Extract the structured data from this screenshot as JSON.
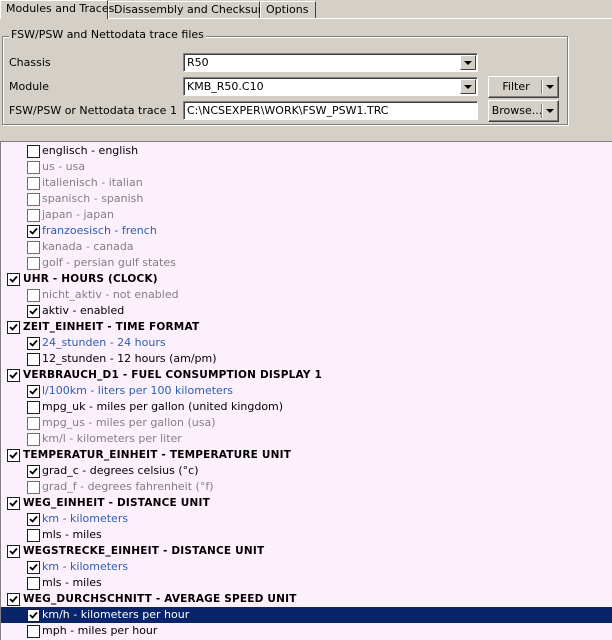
{
  "tabs": [
    {
      "label": "Modules and Traces",
      "active": true
    },
    {
      "label": "Disassembly and Checksums",
      "active": false
    },
    {
      "label": "Options",
      "active": false
    }
  ],
  "group": {
    "title": "FSW/PSW and Nettodata trace files",
    "chassis_label": "Chassis",
    "chassis_value": "R50",
    "module_label": "Module",
    "module_value": "KMB_R50.C10",
    "trace_label": "FSW/PSW or Nettodata trace 1",
    "trace_value": "C:\\NCSEXPER\\WORK\\FSW_PSW1.TRC",
    "filter_label": "Filter",
    "browse_label": "Browse..."
  },
  "tree": {
    "rows": [
      {
        "text": "englisch  -  english",
        "level": 1,
        "checked": false,
        "style": "normal"
      },
      {
        "text": "us  -  usa",
        "level": 1,
        "checked": false,
        "style": "grey"
      },
      {
        "text": "italienisch  -  italian",
        "level": 1,
        "checked": false,
        "style": "grey"
      },
      {
        "text": "spanisch  -  spanish",
        "level": 1,
        "checked": false,
        "style": "grey"
      },
      {
        "text": "japan  -  japan",
        "level": 1,
        "checked": false,
        "style": "grey"
      },
      {
        "text": "franzoesisch  -  french",
        "level": 1,
        "checked": true,
        "style": "blue"
      },
      {
        "text": "kanada  -  canada",
        "level": 1,
        "checked": false,
        "style": "grey"
      },
      {
        "text": "golf  -  persian gulf states",
        "level": 1,
        "checked": false,
        "style": "grey"
      },
      {
        "text": "UHR  -  HOURS (CLOCK)",
        "level": 0,
        "checked": true,
        "style": "head"
      },
      {
        "text": "nicht_aktiv  -  not enabled",
        "level": 1,
        "checked": false,
        "style": "grey"
      },
      {
        "text": "aktiv  -  enabled",
        "level": 1,
        "checked": true,
        "style": "normal"
      },
      {
        "text": "ZEIT_EINHEIT  -  TIME FORMAT",
        "level": 0,
        "checked": true,
        "style": "head"
      },
      {
        "text": "24_stunden  -  24 hours",
        "level": 1,
        "checked": true,
        "style": "blue"
      },
      {
        "text": "12_stunden  -  12 hours (am/pm)",
        "level": 1,
        "checked": false,
        "style": "normal"
      },
      {
        "text": "VERBRAUCH_D1  -  FUEL CONSUMPTION DISPLAY 1",
        "level": 0,
        "checked": true,
        "style": "head"
      },
      {
        "text": "l/100km  -  liters per 100 kilometers",
        "level": 1,
        "checked": true,
        "style": "blue"
      },
      {
        "text": "mpg_uk  -  miles per gallon (united kingdom)",
        "level": 1,
        "checked": false,
        "style": "normal"
      },
      {
        "text": "mpg_us  -  miles per gallon (usa)",
        "level": 1,
        "checked": false,
        "style": "grey"
      },
      {
        "text": "km/l  -  kilometers per liter",
        "level": 1,
        "checked": false,
        "style": "grey"
      },
      {
        "text": "TEMPERATUR_EINHEIT  -  TEMPERATURE UNIT",
        "level": 0,
        "checked": true,
        "style": "head"
      },
      {
        "text": "grad_c  -  degrees celsius (°c)",
        "level": 1,
        "checked": true,
        "style": "normal"
      },
      {
        "text": "grad_f  -  degrees fahrenheit (°f)",
        "level": 1,
        "checked": false,
        "style": "grey"
      },
      {
        "text": "WEG_EINHEIT  -  DISTANCE UNIT",
        "level": 0,
        "checked": true,
        "style": "head"
      },
      {
        "text": "km  -  kilometers",
        "level": 1,
        "checked": true,
        "style": "blue"
      },
      {
        "text": "mls  -  miles",
        "level": 1,
        "checked": false,
        "style": "normal"
      },
      {
        "text": "WEGSTRECKE_EINHEIT  -  DISTANCE UNIT",
        "level": 0,
        "checked": true,
        "style": "head"
      },
      {
        "text": "km  -  kilometers",
        "level": 1,
        "checked": true,
        "style": "blue"
      },
      {
        "text": "mls  -  miles",
        "level": 1,
        "checked": false,
        "style": "normal"
      },
      {
        "text": "WEG_DURCHSCHNITT  -  AVERAGE SPEED UNIT",
        "level": 0,
        "checked": true,
        "style": "head"
      },
      {
        "text": "km/h  -  kilometers per hour",
        "level": 1,
        "checked": true,
        "style": "selected"
      },
      {
        "text": "mph  -  miles per hour",
        "level": 1,
        "checked": false,
        "style": "normal"
      }
    ]
  },
  "colors": {
    "window_bg": "#d4d0c8",
    "tree_bg": "#fdf0fd",
    "selection": "#0a246a",
    "link_blue": "#2b5fae",
    "disabled_grey": "#808080"
  },
  "icons": {
    "checkbox": "checkbox-icon",
    "dropdown": "chevron-down-icon"
  }
}
